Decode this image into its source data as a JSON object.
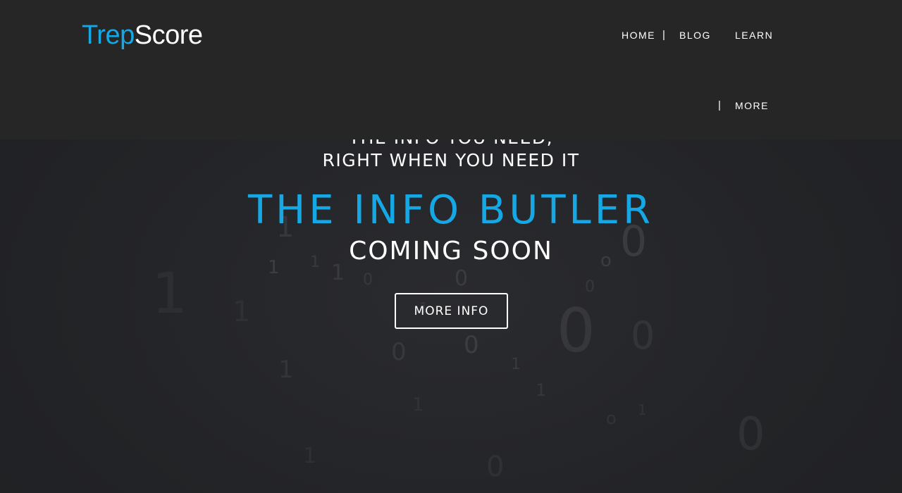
{
  "header": {
    "logo_trep": "Trep",
    "logo_score": "Score",
    "nav": {
      "home": "HOME",
      "blog": "BLOG",
      "learn": "LEARN",
      "more": "MORE",
      "separator": "|"
    }
  },
  "hero": {
    "tagline_line1": "THE INFO YOU NEED,",
    "tagline_line2": "RIGHT WHEN YOU NEED IT",
    "headline": "THE INFO BUTLER",
    "subhead": "COMING SOON",
    "cta_label": "MORE INFO"
  },
  "colors": {
    "accent": "#15a8e4",
    "header_bg": "#262626",
    "page_bg": "#222327",
    "text": "#ffffff"
  }
}
